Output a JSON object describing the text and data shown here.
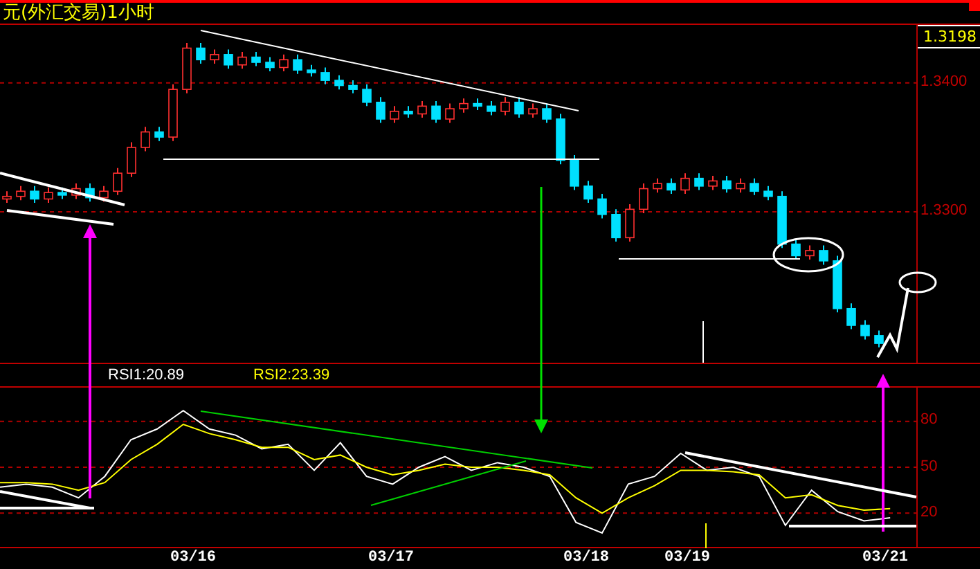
{
  "title_bar": {
    "title": "元(外汇交易)1小时"
  },
  "price_panel": {
    "current_price": "1.3198",
    "chart_data": {
      "type": "candlestick",
      "ylim": [
        1.3183,
        1.3445
      ],
      "grid": true,
      "yticks": [
        {
          "value": 1.34,
          "label": "1.3400"
        },
        {
          "value": 1.33,
          "label": "1.3300"
        }
      ],
      "ohlc": [
        [
          1.331,
          1.3316,
          1.3307,
          1.3312
        ],
        [
          1.3312,
          1.332,
          1.3309,
          1.3316
        ],
        [
          1.3316,
          1.332,
          1.3307,
          1.331
        ],
        [
          1.331,
          1.3319,
          1.3307,
          1.3315
        ],
        [
          1.3315,
          1.3319,
          1.331,
          1.3313
        ],
        [
          1.3313,
          1.3322,
          1.331,
          1.3318
        ],
        [
          1.3318,
          1.3322,
          1.3308,
          1.3311
        ],
        [
          1.3311,
          1.332,
          1.3308,
          1.3316
        ],
        [
          1.3316,
          1.3334,
          1.3313,
          1.333
        ],
        [
          1.333,
          1.3354,
          1.3327,
          1.335
        ],
        [
          1.335,
          1.3366,
          1.3347,
          1.3362
        ],
        [
          1.3362,
          1.3366,
          1.3355,
          1.3358
        ],
        [
          1.3358,
          1.3399,
          1.3355,
          1.3395
        ],
        [
          1.3395,
          1.3431,
          1.3392,
          1.3427
        ],
        [
          1.3427,
          1.3431,
          1.3415,
          1.3418
        ],
        [
          1.3418,
          1.3426,
          1.3415,
          1.3422
        ],
        [
          1.3422,
          1.3426,
          1.3411,
          1.3414
        ],
        [
          1.3414,
          1.3424,
          1.3411,
          1.342
        ],
        [
          1.342,
          1.3424,
          1.3413,
          1.3416
        ],
        [
          1.3416,
          1.342,
          1.3409,
          1.3412
        ],
        [
          1.3412,
          1.3422,
          1.3409,
          1.3418
        ],
        [
          1.3418,
          1.3422,
          1.3407,
          1.341
        ],
        [
          1.341,
          1.3414,
          1.3405,
          1.3408
        ],
        [
          1.3408,
          1.3412,
          1.3399,
          1.3402
        ],
        [
          1.3402,
          1.3406,
          1.3395,
          1.3398
        ],
        [
          1.3398,
          1.3402,
          1.3392,
          1.3395
        ],
        [
          1.3395,
          1.3399,
          1.3382,
          1.3385
        ],
        [
          1.3385,
          1.3389,
          1.3369,
          1.3372
        ],
        [
          1.3372,
          1.3382,
          1.3369,
          1.3378
        ],
        [
          1.3378,
          1.3382,
          1.3373,
          1.3376
        ],
        [
          1.3376,
          1.3386,
          1.3373,
          1.3382
        ],
        [
          1.3382,
          1.3386,
          1.3369,
          1.3372
        ],
        [
          1.3372,
          1.3384,
          1.3369,
          1.338
        ],
        [
          1.338,
          1.3388,
          1.3377,
          1.3384
        ],
        [
          1.3384,
          1.3388,
          1.3379,
          1.3382
        ],
        [
          1.3382,
          1.3386,
          1.3375,
          1.3378
        ],
        [
          1.3378,
          1.3389,
          1.3375,
          1.3385
        ],
        [
          1.3385,
          1.3389,
          1.3373,
          1.3376
        ],
        [
          1.3376,
          1.3384,
          1.3373,
          1.338
        ],
        [
          1.338,
          1.3384,
          1.3369,
          1.3372
        ],
        [
          1.3372,
          1.3376,
          1.3337,
          1.334
        ],
        [
          1.334,
          1.3344,
          1.3317,
          1.332
        ],
        [
          1.332,
          1.3324,
          1.3307,
          1.331
        ],
        [
          1.331,
          1.3314,
          1.3295,
          1.3298
        ],
        [
          1.3298,
          1.3302,
          1.3277,
          1.328
        ],
        [
          1.328,
          1.3306,
          1.3277,
          1.3302
        ],
        [
          1.3302,
          1.3322,
          1.3299,
          1.3318
        ],
        [
          1.3318,
          1.3326,
          1.3315,
          1.3322
        ],
        [
          1.3322,
          1.3326,
          1.3314,
          1.3317
        ],
        [
          1.3317,
          1.333,
          1.3314,
          1.3326
        ],
        [
          1.3326,
          1.333,
          1.3317,
          1.332
        ],
        [
          1.332,
          1.3328,
          1.3317,
          1.3324
        ],
        [
          1.3324,
          1.3328,
          1.3315,
          1.3318
        ],
        [
          1.3318,
          1.3326,
          1.3315,
          1.3322
        ],
        [
          1.3322,
          1.3326,
          1.3313,
          1.3316
        ],
        [
          1.3316,
          1.332,
          1.3309,
          1.3312
        ],
        [
          1.3312,
          1.3316,
          1.3272,
          1.3275
        ],
        [
          1.3275,
          1.3279,
          1.3263,
          1.3266
        ],
        [
          1.3266,
          1.3274,
          1.3263,
          1.327
        ],
        [
          1.327,
          1.3274,
          1.3259,
          1.3262
        ],
        [
          1.3262,
          1.3266,
          1.3222,
          1.3225
        ],
        [
          1.3225,
          1.3229,
          1.3209,
          1.3212
        ],
        [
          1.3212,
          1.3216,
          1.3201,
          1.3204
        ],
        [
          1.3204,
          1.3208,
          1.3195,
          1.3198
        ]
      ]
    }
  },
  "rsi_panel": {
    "readings": [
      ":20.89",
      ":23.39"
    ],
    "chart_data": {
      "type": "line",
      "ylim": [
        -2,
        102
      ],
      "grid": true,
      "yticks": [
        {
          "value": 80,
          "label": "80"
        },
        {
          "value": 50,
          "label": "50"
        },
        {
          "value": 20,
          "label": "20"
        }
      ],
      "series": [
        {
          "name": "RSI1",
          "color": "#ffffff",
          "values": [
            37,
            39,
            37,
            30,
            44,
            68,
            75,
            87,
            75,
            71,
            62,
            65,
            48,
            66,
            44,
            39,
            50,
            57,
            48,
            53,
            50,
            44,
            14,
            7,
            39,
            44,
            59,
            48,
            50,
            44,
            12,
            35,
            21,
            15,
            17,
            null
          ]
        },
        {
          "name": "RSI2",
          "color": "#ffff00",
          "values": [
            40,
            40,
            39,
            35,
            40,
            55,
            65,
            78,
            72,
            68,
            63,
            63,
            55,
            58,
            50,
            45,
            48,
            52,
            50,
            50,
            48,
            45,
            30,
            20,
            30,
            38,
            48,
            48,
            47,
            45,
            30,
            32,
            25,
            22,
            23,
            null
          ]
        }
      ]
    }
  },
  "date_axis": [
    "03/16",
    "03/17",
    "03/18",
    "03/19",
    "03/21"
  ]
}
